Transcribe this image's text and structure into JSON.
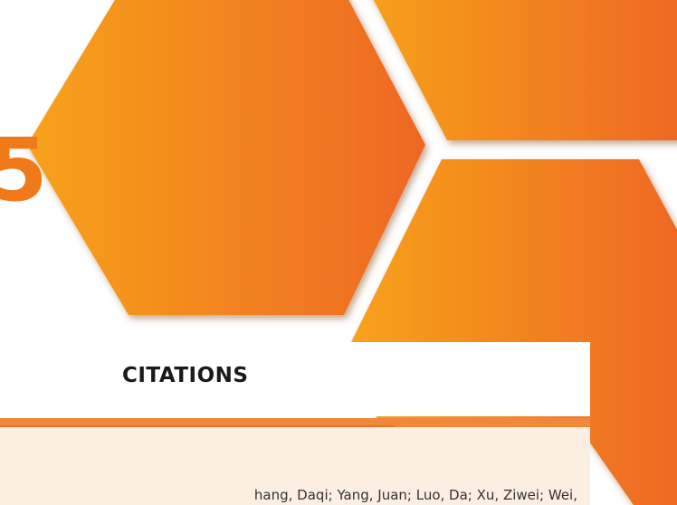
{
  "decoration": {
    "hexagon_gradient_start": "#f7a21d",
    "hexagon_gradient_end": "#ee6722",
    "background": "#ffffff",
    "brand_glyph": "5",
    "brand_color": "#f07a1a"
  },
  "citations": {
    "title": "CITATIONS",
    "accent_color": "#f0883a",
    "panel_color": "#fdeee2",
    "first_entry_visible": "hang, Daqi; Yang, Juan; Luo, Da; Xu, Ziwei; Wei,"
  }
}
